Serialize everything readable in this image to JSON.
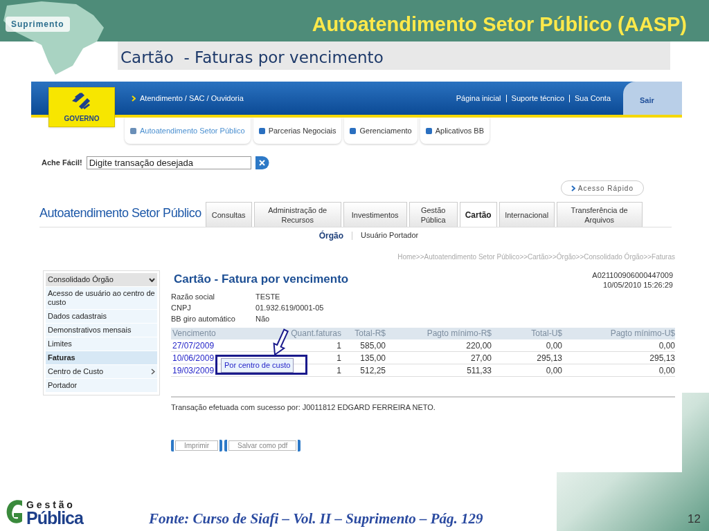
{
  "slide": {
    "badge": "Suprimento",
    "title": "Autoatendimento Setor Público (AASP)",
    "subtitle": "Cartão  - Faturas por vencimento",
    "logo_top": "G e s t ã o",
    "logo_bottom": "Pública",
    "source": "Fonte: Curso de Siafi – Vol. II – Suprimento – Pág. 129",
    "page_number": "12"
  },
  "screenshot": {
    "header": {
      "logo_label": "GOVERNO",
      "service_link": "Atendimento / SAC / Ouvidoria",
      "top_links": [
        "Página inicial",
        "Suporte técnico",
        "Sua Conta"
      ],
      "logout": "Sair"
    },
    "main_nav": [
      {
        "label": "Autoatendimento Setor Público",
        "selected": true
      },
      {
        "label": "Parcerias Negociais",
        "selected": false
      },
      {
        "label": "Gerenciamento",
        "selected": false
      },
      {
        "label": "Aplicativos BB",
        "selected": false
      }
    ],
    "search": {
      "label": "Ache Fácil!",
      "placeholder": "Digite transação desejada"
    },
    "quick_access": "Acesso Rápido",
    "section_title": "Autoatendimento Setor Público",
    "tabs": [
      {
        "label": "Consultas",
        "selected": false
      },
      {
        "label": "Administração de Recursos",
        "selected": false
      },
      {
        "label": "Investimentos",
        "selected": false
      },
      {
        "label": "Gestão Pública",
        "selected": false
      },
      {
        "label": "Cartão",
        "selected": true
      },
      {
        "label": "Internacional",
        "selected": false
      },
      {
        "label": "Transferência de Arquivos",
        "selected": false
      }
    ],
    "subtabs": [
      {
        "label": "Órgão",
        "selected": true
      },
      {
        "label": "Usuário Portador",
        "selected": false
      }
    ],
    "breadcrumb": "Home>>Autoatendimento Setor Público>>Cartão>>Órgão>>Consolidado Órgão>>Faturas",
    "sidebar": {
      "items": [
        {
          "label": "Consolidado Órgão",
          "kind": "header",
          "selected": false
        },
        {
          "label": "Acesso de usuário ao centro de custo",
          "kind": "item",
          "selected": false
        },
        {
          "label": "Dados cadastrais",
          "kind": "item",
          "selected": false
        },
        {
          "label": "Demonstrativos mensais",
          "kind": "item",
          "selected": false
        },
        {
          "label": "Limites",
          "kind": "item",
          "selected": false
        },
        {
          "label": "Faturas",
          "kind": "item",
          "selected": true
        },
        {
          "label": "Centro de Custo",
          "kind": "submenu",
          "selected": false
        },
        {
          "label": "Portador",
          "kind": "item",
          "selected": false
        }
      ]
    },
    "content": {
      "title": "Cartão - Fatura por vencimento",
      "code": "A021100906000447009",
      "datetime": "10/05/2010 15:26:29",
      "fields": [
        {
          "label": "Razão social",
          "value": "TESTE"
        },
        {
          "label": "CNPJ",
          "value": "01.932.619/0001-05"
        },
        {
          "label": "BB giro automático",
          "value": "Não"
        }
      ],
      "table": {
        "columns": [
          "Vencimento",
          "Quant.faturas",
          "Total-R$",
          "Pagto mínimo-R$",
          "Total-U$",
          "Pagto mínimo-U$"
        ],
        "rows": [
          [
            "27/07/2009",
            "1",
            "585,00",
            "220,00",
            "0,00",
            "0,00"
          ],
          [
            "10/06/2009",
            "1",
            "135,00",
            "27,00",
            "295,13",
            "295,13"
          ],
          [
            "19/03/2009",
            "1",
            "512,25",
            "511,33",
            "0,00",
            "0,00"
          ]
        ]
      },
      "tooltip": "Por centro de custo",
      "status": "Transação efetuada com sucesso por: J0011812 EDGARD FERREIRA NETO.",
      "buttons": [
        "Imprimir",
        "Salvar como pdf"
      ]
    }
  }
}
